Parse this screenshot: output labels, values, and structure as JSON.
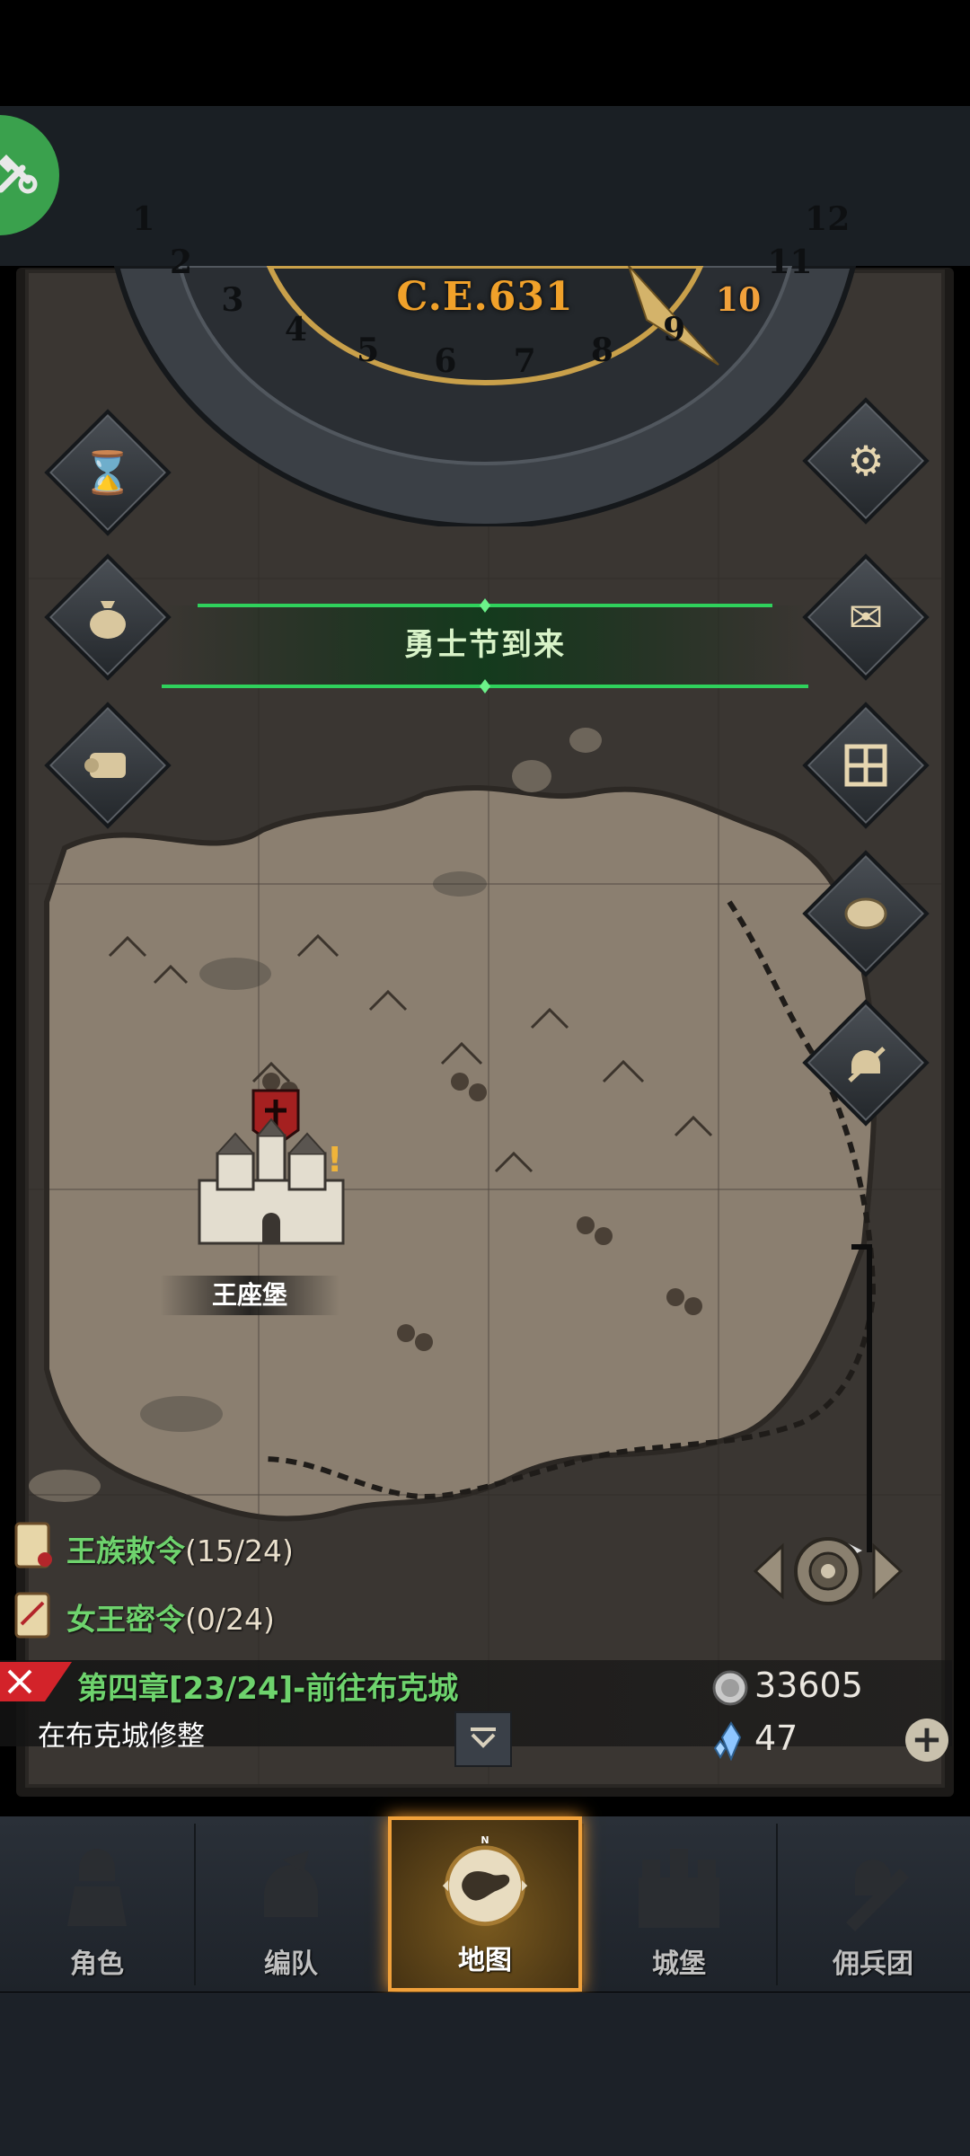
{
  "calendar": {
    "year": "C.E.631",
    "months": [
      "1",
      "2",
      "3",
      "4",
      "5",
      "6",
      "7",
      "8",
      "9",
      "10",
      "11",
      "12"
    ],
    "current_month": "10"
  },
  "banner": {
    "text": "勇士节到来"
  },
  "map": {
    "castle_name": "王座堡"
  },
  "left_buttons": [
    {
      "icon": "hourglass-icon"
    },
    {
      "icon": "money-bag-icon"
    },
    {
      "icon": "scroll-icon"
    }
  ],
  "right_buttons": [
    {
      "icon": "gear-icon"
    },
    {
      "icon": "mail-icon"
    },
    {
      "icon": "grid-icon"
    },
    {
      "icon": "coin-icon"
    },
    {
      "icon": "helmet-sword-icon"
    }
  ],
  "quests": [
    {
      "name": "王族敕令",
      "count": "(15/24)"
    },
    {
      "name": "女王密令",
      "count": "(0/24)"
    }
  ],
  "chapter": {
    "title": "第四章[23/24]-前往布克城",
    "subtitle": "在布克城修整"
  },
  "resources": {
    "silver": "33605",
    "gems": "47"
  },
  "nav": [
    {
      "label": "角色",
      "icon": "knight-icon",
      "active": false
    },
    {
      "label": "编队",
      "icon": "helmet-icon",
      "active": false
    },
    {
      "label": "地图",
      "icon": "compass-map-icon",
      "active": true
    },
    {
      "label": "城堡",
      "icon": "castle-icon",
      "active": false
    },
    {
      "label": "佣兵团",
      "icon": "mercenary-icon",
      "active": false
    }
  ],
  "colors": {
    "accent": "#f1a13b",
    "quest_green": "#6ed36d",
    "banner_green": "#2fd15c",
    "fab_green": "#3aa14d"
  }
}
